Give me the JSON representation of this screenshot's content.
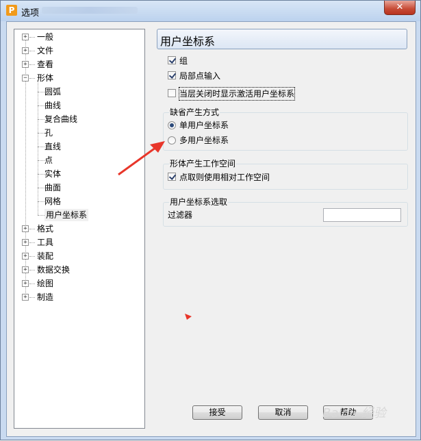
{
  "window": {
    "title": "选项",
    "app_icon_letter": "P",
    "close_symbol": "✕"
  },
  "tree": {
    "items": [
      {
        "label": "一般",
        "expander": "+"
      },
      {
        "label": "文件",
        "expander": "+"
      },
      {
        "label": "查看",
        "expander": "+"
      },
      {
        "label": "形体",
        "expander": "−"
      },
      {
        "label": "圆弧"
      },
      {
        "label": "曲线"
      },
      {
        "label": "复合曲线"
      },
      {
        "label": "孔"
      },
      {
        "label": "直线"
      },
      {
        "label": "点"
      },
      {
        "label": "实体"
      },
      {
        "label": "曲面"
      },
      {
        "label": "网格"
      },
      {
        "label": "用户坐标系",
        "selected": true
      },
      {
        "label": "格式",
        "expander": "+"
      },
      {
        "label": "工具",
        "expander": "+"
      },
      {
        "label": "装配",
        "expander": "+"
      },
      {
        "label": "数据交换",
        "expander": "+"
      },
      {
        "label": "绘图",
        "expander": "+"
      },
      {
        "label": "制造",
        "expander": "+"
      }
    ]
  },
  "panel": {
    "title": "用户坐标系",
    "checks": [
      {
        "label": "组",
        "checked": true
      },
      {
        "label": "局部点输入",
        "checked": true
      },
      {
        "label": "当层关闭时显示激活用户坐标系",
        "checked": false
      }
    ],
    "default_mode": {
      "title": "缺省产生方式",
      "options": [
        {
          "label": "单用户坐标系",
          "selected": true
        },
        {
          "label": "多用户坐标系",
          "selected": false
        }
      ]
    },
    "workspace": {
      "title": "形体产生工作空间",
      "check_label": "点取则使用相对工作空间",
      "checked": true
    },
    "ucs_select": {
      "title": "用户坐标系选取",
      "filter_label": "过滤器",
      "filter_value": ""
    }
  },
  "buttons": {
    "ok": "接受",
    "cancel": "取消",
    "help": "帮助"
  },
  "watermark": "Baidu 经验",
  "colors": {
    "annotation_arrow": "#e8362a",
    "close_button": "#c74a35",
    "app_icon": "#f19a1a"
  }
}
